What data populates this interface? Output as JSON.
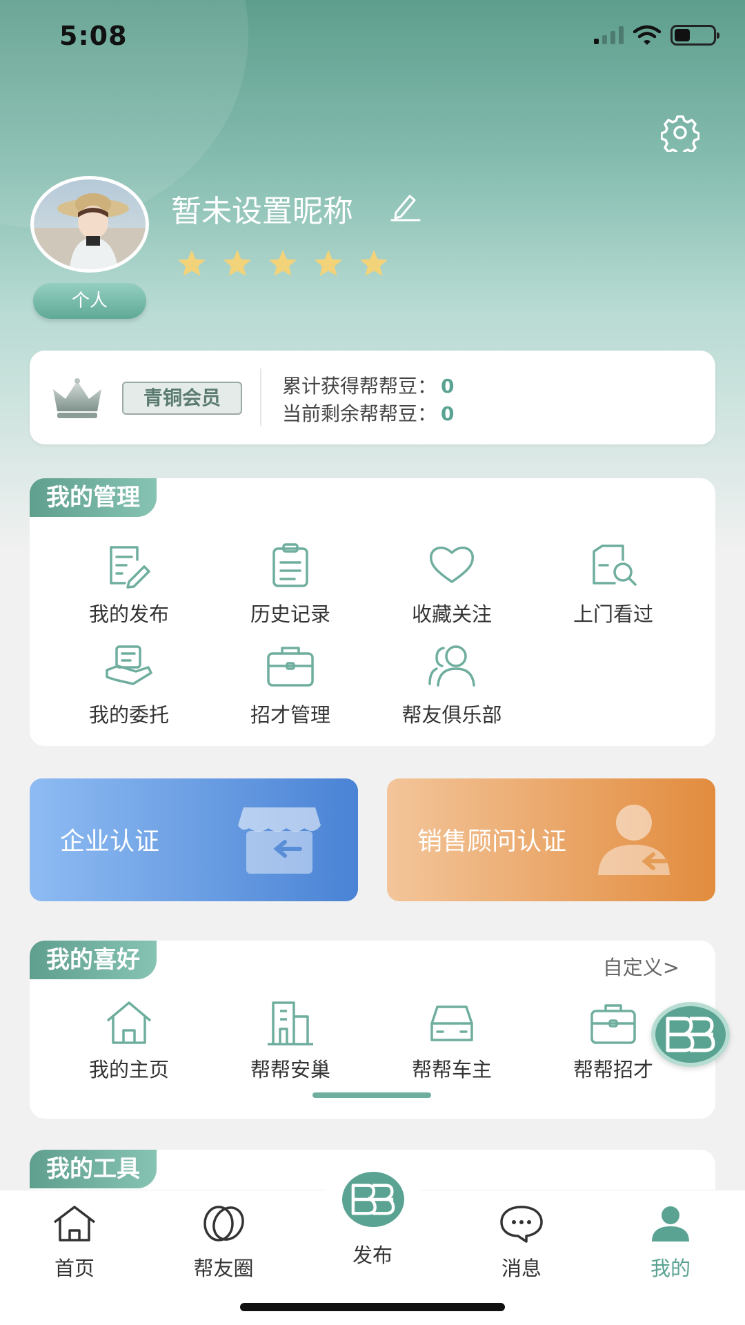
{
  "status_bar": {
    "time": "5:08"
  },
  "profile": {
    "nickname": "暂未设置昵称",
    "role": "个人",
    "rating": 5
  },
  "membership": {
    "level": "青铜会员",
    "total_label": "累计获得帮帮豆：",
    "total_value": "0",
    "remaining_label": "当前剩余帮帮豆：",
    "remaining_value": "0"
  },
  "management": {
    "title": "我的管理",
    "items": [
      {
        "label": "我的发布",
        "icon": "edit-document-icon"
      },
      {
        "label": "历史记录",
        "icon": "clipboard-icon"
      },
      {
        "label": "收藏关注",
        "icon": "heart-icon"
      },
      {
        "label": "上门看过",
        "icon": "search-document-icon"
      },
      {
        "label": "我的委托",
        "icon": "hand-document-icon"
      },
      {
        "label": "招才管理",
        "icon": "briefcase-icon"
      },
      {
        "label": "帮友俱乐部",
        "icon": "users-icon"
      }
    ]
  },
  "certifications": {
    "enterprise": "企业认证",
    "sales": "销售顾问认证"
  },
  "preferences": {
    "title": "我的喜好",
    "customize": "自定义>",
    "items": [
      {
        "label": "我的主页",
        "icon": "home-icon"
      },
      {
        "label": "帮帮安巢",
        "icon": "building-icon"
      },
      {
        "label": "帮帮车主",
        "icon": "car-icon"
      },
      {
        "label": "帮帮招才",
        "icon": "briefcase-icon"
      }
    ]
  },
  "tools": {
    "title": "我的工具"
  },
  "tabbar": {
    "items": [
      {
        "label": "首页",
        "icon": "home-icon"
      },
      {
        "label": "帮友圈",
        "icon": "circles-icon"
      },
      {
        "label": "发布",
        "icon": "publish-logo-icon"
      },
      {
        "label": "消息",
        "icon": "chat-bubble-icon"
      },
      {
        "label": "我的",
        "icon": "person-icon"
      }
    ],
    "active": "我的"
  },
  "colors": {
    "brand": "#5aa392",
    "header_top": "#5e9e8d",
    "enterprise_gradient": "#4a83d5",
    "sales_gradient": "#e28c3e",
    "star": "#f2d37a"
  }
}
